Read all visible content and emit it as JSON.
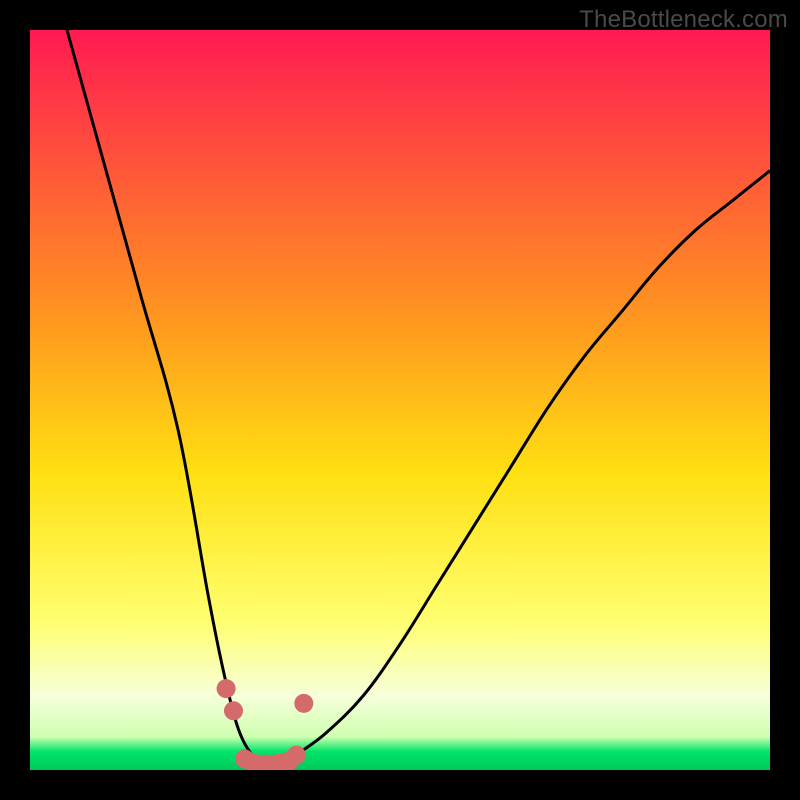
{
  "watermark": "TheBottleneck.com",
  "colors": {
    "top": "#ff1a52",
    "mid_upper": "#ff7a2a",
    "mid": "#ffe012",
    "mid_lower": "#ffff70",
    "pale": "#f6ffda",
    "green": "#00e56a",
    "curve": "#000000",
    "marker": "#d46a6a",
    "frame": "#000000"
  },
  "chart_data": {
    "type": "line",
    "title": "",
    "xlabel": "",
    "ylabel": "",
    "xlim": [
      0,
      100
    ],
    "ylim": [
      0,
      100
    ],
    "series": [
      {
        "name": "bottleneck-curve",
        "x": [
          5,
          10,
          15,
          20,
          24,
          26,
          28,
          30,
          32,
          34,
          36,
          40,
          45,
          50,
          55,
          60,
          65,
          70,
          75,
          80,
          85,
          90,
          95,
          100
        ],
        "values": [
          100,
          82,
          64,
          46,
          24,
          14,
          6,
          2,
          0,
          0,
          2,
          5,
          10,
          17,
          25,
          33,
          41,
          49,
          56,
          62,
          68,
          73,
          77,
          81
        ]
      }
    ],
    "markers": {
      "name": "highlighted-points",
      "x": [
        26.5,
        27.5,
        29,
        30,
        31,
        32,
        33,
        34,
        35,
        36,
        37
      ],
      "values": [
        11,
        8,
        1.5,
        1,
        0.8,
        0.8,
        0.8,
        1,
        1.2,
        2,
        9
      ]
    },
    "gradient_stops": [
      {
        "pos": 0.0,
        "color": "#ff1a52"
      },
      {
        "pos": 0.4,
        "color": "#ff9a1e"
      },
      {
        "pos": 0.6,
        "color": "#ffe012"
      },
      {
        "pos": 0.8,
        "color": "#ffff70"
      },
      {
        "pos": 0.9,
        "color": "#f6ffda"
      },
      {
        "pos": 0.955,
        "color": "#cfffb0"
      },
      {
        "pos": 0.975,
        "color": "#00e56a"
      },
      {
        "pos": 1.0,
        "color": "#00c85c"
      }
    ]
  }
}
